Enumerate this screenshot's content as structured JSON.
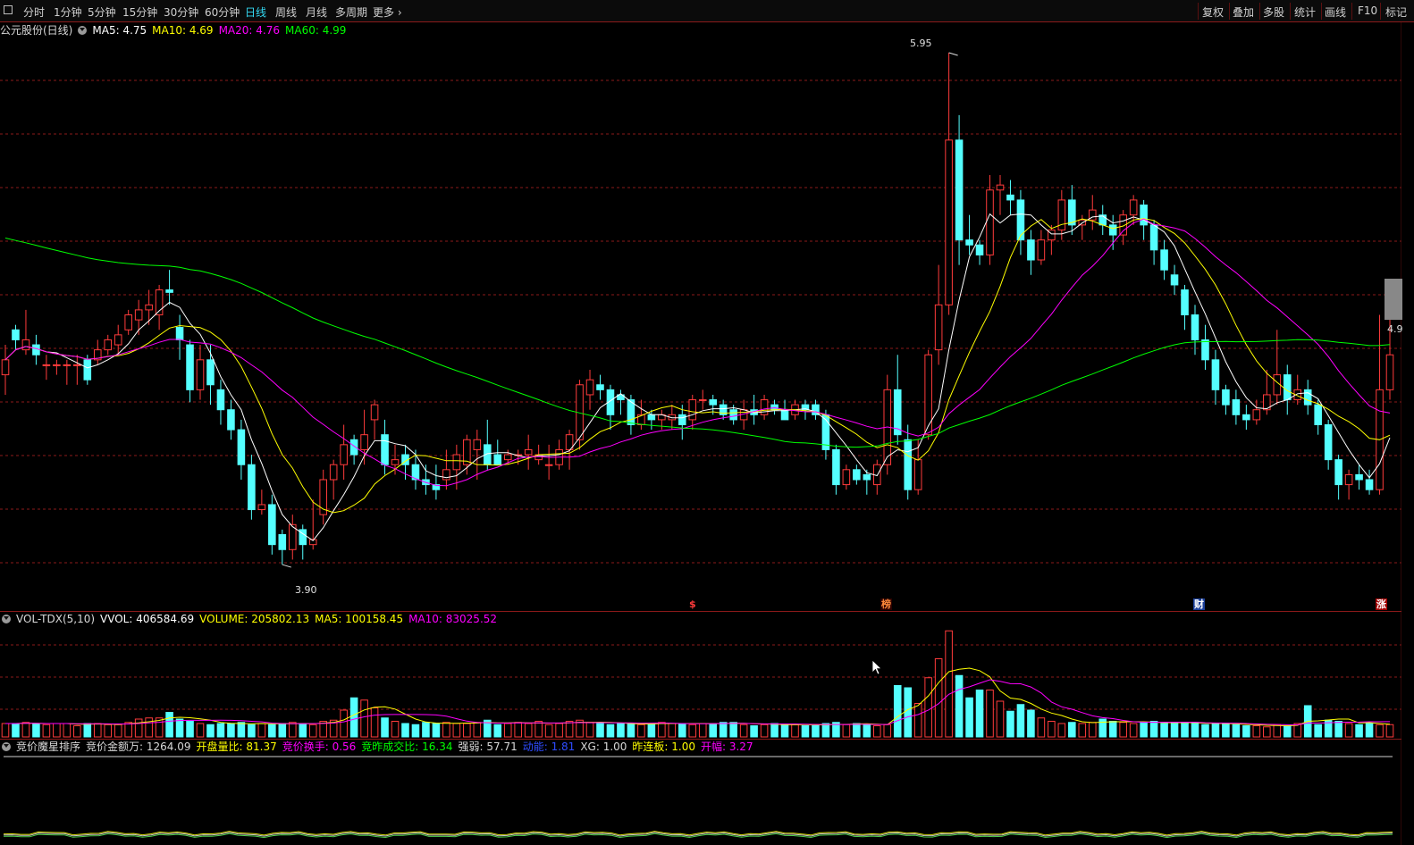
{
  "toolbar": {
    "periods": [
      "分时",
      "1分钟",
      "5分钟",
      "15分钟",
      "30分钟",
      "60分钟",
      "日线",
      "周线",
      "月线",
      "多周期",
      "更多"
    ],
    "active_period": "日线",
    "tools": [
      "复权",
      "叠加",
      "多股",
      "统计",
      "画线",
      "F10",
      "标记"
    ]
  },
  "main_legend": {
    "title": "公元股份(日线)",
    "ma5": "MA5: 4.75",
    "ma10": "MA10: 4.69",
    "ma20": "MA20: 4.76",
    "ma60": "MA60: 4.99"
  },
  "price_labels": {
    "high": "5.95",
    "low": "3.90",
    "right": "4.9"
  },
  "event_markers": {
    "first": "$",
    "second": "榜",
    "third": "财",
    "fourth": "涨"
  },
  "vol_legend": {
    "name": "VOL-TDX(5,10)",
    "vvol": "VVOL: 406584.69",
    "volume": "VOLUME: 205802.13",
    "ma5": "MA5: 100158.45",
    "ma10": "MA10: 83025.52"
  },
  "ind_legend": {
    "name": "竞价魔星排序",
    "amount": "竞价金额万: 1264.09",
    "open_ratio": "开盘量比: 81.37",
    "turnover": "竞价换手: 0.56",
    "ratio": "竞昨成交比: 16.34",
    "strength": "强弱: 57.71",
    "momentum": "动能: 1.81",
    "xg": "XG: 1.00",
    "limit": "昨连板: 1.00",
    "open_range": "开幅: 3.27"
  },
  "colors": {
    "up": "#ff3b3b",
    "down": "#54ffff",
    "ma5": "#ffffff",
    "ma10": "#ffff00",
    "ma20": "#ff00ff",
    "ma60": "#00ff00",
    "grid": "#8b1a1a",
    "active_tab": "#34d9f2"
  },
  "chart_data": {
    "type": "candlestick",
    "series_name": "公元股份(日线)",
    "ylim": [
      3.8,
      6.0
    ],
    "high": 5.95,
    "low": 3.9,
    "indicators": {
      "MA5": 4.75,
      "MA10": 4.69,
      "MA20": 4.76,
      "MA60": 4.99
    },
    "candles": [
      [
        4.66,
        4.72,
        4.58,
        4.78
      ],
      [
        4.84,
        4.8,
        4.76,
        4.86
      ],
      [
        4.76,
        4.8,
        4.74,
        4.92
      ],
      [
        4.78,
        4.74,
        4.7,
        4.82
      ],
      [
        4.7,
        4.7,
        4.64,
        4.74
      ],
      [
        4.7,
        4.7,
        4.66,
        4.72
      ],
      [
        4.7,
        4.7,
        4.62,
        4.72
      ],
      [
        4.7,
        4.7,
        4.62,
        4.74
      ],
      [
        4.72,
        4.64,
        4.62,
        4.74
      ],
      [
        4.72,
        4.76,
        4.7,
        4.8
      ],
      [
        4.76,
        4.8,
        4.74,
        4.82
      ],
      [
        4.78,
        4.82,
        4.74,
        4.86
      ],
      [
        4.84,
        4.9,
        4.82,
        4.92
      ],
      [
        4.88,
        4.92,
        4.82,
        4.96
      ],
      [
        4.92,
        4.94,
        4.86,
        5.0
      ],
      [
        4.9,
        5.0,
        4.84,
        5.02
      ],
      [
        5.0,
        4.99,
        4.94,
        5.08
      ],
      [
        4.85,
        4.8,
        4.72,
        4.9
      ],
      [
        4.78,
        4.6,
        4.55,
        4.8
      ],
      [
        4.6,
        4.72,
        4.56,
        4.78
      ],
      [
        4.72,
        4.62,
        4.54,
        4.78
      ],
      [
        4.6,
        4.52,
        4.46,
        4.64
      ],
      [
        4.52,
        4.44,
        4.4,
        4.56
      ],
      [
        4.44,
        4.3,
        4.24,
        4.48
      ],
      [
        4.3,
        4.12,
        4.08,
        4.34
      ],
      [
        4.12,
        4.14,
        4.1,
        4.2
      ],
      [
        4.14,
        3.98,
        3.94,
        4.18
      ],
      [
        4.02,
        3.96,
        3.9,
        4.04
      ],
      [
        3.96,
        4.06,
        3.92,
        4.1
      ],
      [
        4.04,
        3.98,
        3.92,
        4.06
      ],
      [
        3.98,
        4.0,
        3.96,
        4.16
      ],
      [
        4.1,
        4.24,
        4.06,
        4.28
      ],
      [
        4.24,
        4.3,
        4.16,
        4.32
      ],
      [
        4.3,
        4.38,
        4.24,
        4.46
      ],
      [
        4.4,
        4.34,
        4.3,
        4.42
      ],
      [
        4.36,
        4.42,
        4.3,
        4.52
      ],
      [
        4.48,
        4.54,
        4.4,
        4.56
      ],
      [
        4.42,
        4.3,
        4.26,
        4.48
      ],
      [
        4.3,
        4.32,
        4.26,
        4.38
      ],
      [
        4.34,
        4.3,
        4.24,
        4.38
      ],
      [
        4.3,
        4.24,
        4.2,
        4.36
      ],
      [
        4.24,
        4.22,
        4.18,
        4.3
      ],
      [
        4.22,
        4.2,
        4.16,
        4.3
      ],
      [
        4.24,
        4.28,
        4.2,
        4.36
      ],
      [
        4.28,
        4.34,
        4.2,
        4.38
      ],
      [
        4.3,
        4.4,
        4.26,
        4.42
      ],
      [
        4.36,
        4.4,
        4.24,
        4.44
      ],
      [
        4.38,
        4.3,
        4.28,
        4.48
      ],
      [
        4.34,
        4.3,
        4.3,
        4.4
      ],
      [
        4.32,
        4.34,
        4.3,
        4.36
      ],
      [
        4.34,
        4.34,
        4.3,
        4.36
      ],
      [
        4.34,
        4.36,
        4.28,
        4.42
      ],
      [
        4.32,
        4.34,
        4.3,
        4.38
      ],
      [
        4.3,
        4.3,
        4.24,
        4.38
      ],
      [
        4.3,
        4.36,
        4.28,
        4.4
      ],
      [
        4.36,
        4.42,
        4.28,
        4.44
      ],
      [
        4.4,
        4.62,
        4.36,
        4.64
      ],
      [
        4.58,
        4.64,
        4.52,
        4.68
      ],
      [
        4.62,
        4.6,
        4.56,
        4.66
      ],
      [
        4.6,
        4.5,
        4.44,
        4.62
      ],
      [
        4.58,
        4.56,
        4.5,
        4.6
      ],
      [
        4.56,
        4.46,
        4.42,
        4.58
      ],
      [
        4.46,
        4.5,
        4.44,
        4.56
      ],
      [
        4.5,
        4.48,
        4.44,
        4.52
      ],
      [
        4.48,
        4.5,
        4.44,
        4.52
      ],
      [
        4.48,
        4.5,
        4.44,
        4.54
      ],
      [
        4.5,
        4.46,
        4.4,
        4.54
      ],
      [
        4.48,
        4.56,
        4.44,
        4.58
      ],
      [
        4.56,
        4.56,
        4.52,
        4.6
      ],
      [
        4.56,
        4.54,
        4.5,
        4.58
      ],
      [
        4.54,
        4.5,
        4.48,
        4.56
      ],
      [
        4.52,
        4.48,
        4.46,
        4.54
      ],
      [
        4.48,
        4.52,
        4.44,
        4.56
      ],
      [
        4.52,
        4.5,
        4.46,
        4.58
      ],
      [
        4.5,
        4.56,
        4.48,
        4.58
      ],
      [
        4.54,
        4.52,
        4.5,
        4.56
      ],
      [
        4.52,
        4.48,
        4.48,
        4.56
      ],
      [
        4.5,
        4.54,
        4.48,
        4.56
      ],
      [
        4.54,
        4.52,
        4.48,
        4.56
      ],
      [
        4.54,
        4.5,
        4.48,
        4.56
      ],
      [
        4.5,
        4.36,
        4.32,
        4.52
      ],
      [
        4.36,
        4.22,
        4.18,
        4.38
      ],
      [
        4.22,
        4.28,
        4.2,
        4.3
      ],
      [
        4.28,
        4.24,
        4.22,
        4.3
      ],
      [
        4.26,
        4.24,
        4.18,
        4.28
      ],
      [
        4.22,
        4.3,
        4.18,
        4.32
      ],
      [
        4.3,
        4.6,
        4.26,
        4.66
      ],
      [
        4.6,
        4.42,
        4.38,
        4.74
      ],
      [
        4.4,
        4.2,
        4.16,
        4.46
      ],
      [
        4.2,
        4.32,
        4.18,
        4.4
      ],
      [
        4.42,
        4.74,
        4.4,
        4.76
      ],
      [
        4.76,
        4.94,
        4.7,
        5.1
      ],
      [
        4.94,
        5.6,
        4.9,
        5.95
      ],
      [
        5.6,
        5.2,
        5.1,
        5.7
      ],
      [
        5.2,
        5.18,
        5.14,
        5.3
      ],
      [
        5.18,
        5.14,
        5.1,
        5.2
      ],
      [
        5.14,
        5.4,
        5.1,
        5.46
      ],
      [
        5.4,
        5.42,
        5.3,
        5.46
      ],
      [
        5.38,
        5.36,
        5.3,
        5.44
      ],
      [
        5.36,
        5.2,
        5.14,
        5.4
      ],
      [
        5.2,
        5.12,
        5.06,
        5.24
      ],
      [
        5.12,
        5.2,
        5.1,
        5.24
      ],
      [
        5.2,
        5.24,
        5.14,
        5.26
      ],
      [
        5.24,
        5.36,
        5.2,
        5.4
      ],
      [
        5.36,
        5.26,
        5.22,
        5.42
      ],
      [
        5.26,
        5.28,
        5.2,
        5.3
      ],
      [
        5.28,
        5.32,
        5.24,
        5.38
      ],
      [
        5.3,
        5.26,
        5.22,
        5.34
      ],
      [
        5.26,
        5.22,
        5.16,
        5.3
      ],
      [
        5.22,
        5.3,
        5.18,
        5.32
      ],
      [
        5.3,
        5.36,
        5.26,
        5.38
      ],
      [
        5.34,
        5.26,
        5.2,
        5.36
      ],
      [
        5.26,
        5.16,
        5.1,
        5.28
      ],
      [
        5.16,
        5.08,
        5.04,
        5.2
      ],
      [
        5.06,
        5.02,
        4.98,
        5.1
      ],
      [
        5.0,
        4.9,
        4.84,
        5.02
      ],
      [
        4.9,
        4.8,
        4.74,
        4.94
      ],
      [
        4.8,
        4.72,
        4.68,
        4.86
      ],
      [
        4.72,
        4.6,
        4.54,
        4.76
      ],
      [
        4.6,
        4.54,
        4.5,
        4.62
      ],
      [
        4.56,
        4.5,
        4.46,
        4.6
      ],
      [
        4.5,
        4.48,
        4.44,
        4.54
      ],
      [
        4.48,
        4.52,
        4.46,
        4.56
      ],
      [
        4.52,
        4.58,
        4.5,
        4.68
      ],
      [
        4.58,
        4.66,
        4.54,
        4.84
      ],
      [
        4.66,
        4.56,
        4.5,
        4.7
      ],
      [
        4.56,
        4.6,
        4.54,
        4.66
      ],
      [
        4.6,
        4.54,
        4.5,
        4.64
      ],
      [
        4.54,
        4.46,
        4.42,
        4.56
      ],
      [
        4.46,
        4.32,
        4.28,
        4.48
      ],
      [
        4.32,
        4.22,
        4.16,
        4.34
      ],
      [
        4.22,
        4.26,
        4.16,
        4.28
      ],
      [
        4.26,
        4.24,
        4.2,
        4.3
      ],
      [
        4.24,
        4.2,
        4.18,
        4.28
      ],
      [
        4.2,
        4.6,
        4.18,
        4.9
      ],
      [
        4.6,
        4.74,
        4.56,
        4.98
      ]
    ],
    "volume": {
      "series_name": "VOL-TDX(5,10)",
      "values": [
        12,
        12,
        13,
        12,
        11,
        12,
        12,
        10,
        12,
        12,
        11,
        11,
        13,
        16,
        17,
        17,
        22,
        16,
        14,
        12,
        11,
        12,
        12,
        13,
        11,
        12,
        11,
        12,
        13,
        12,
        11,
        14,
        15,
        24,
        35,
        33,
        26,
        17,
        14,
        12,
        11,
        13,
        12,
        13,
        12,
        12,
        13,
        15,
        11,
        12,
        13,
        12,
        14,
        11,
        12,
        14,
        15,
        13,
        12,
        11,
        12,
        12,
        11,
        12,
        13,
        12,
        12,
        11,
        12,
        12,
        13,
        13,
        11,
        10,
        11,
        12,
        11,
        11,
        10,
        10,
        12,
        13,
        11,
        12,
        11,
        10,
        11,
        46,
        44,
        30,
        53,
        70,
        95,
        55,
        35,
        42,
        42,
        32,
        23,
        29,
        24,
        17,
        14,
        12,
        13,
        12,
        13,
        16,
        14,
        13,
        12,
        13,
        14,
        12,
        13,
        12,
        13,
        11,
        12,
        12,
        11,
        10,
        10,
        9,
        11,
        10,
        12,
        28,
        11,
        15,
        14,
        12,
        11,
        12,
        11,
        11,
        10,
        10,
        12,
        13,
        18,
        32
      ],
      "ylim": [
        0,
        100
      ]
    }
  }
}
